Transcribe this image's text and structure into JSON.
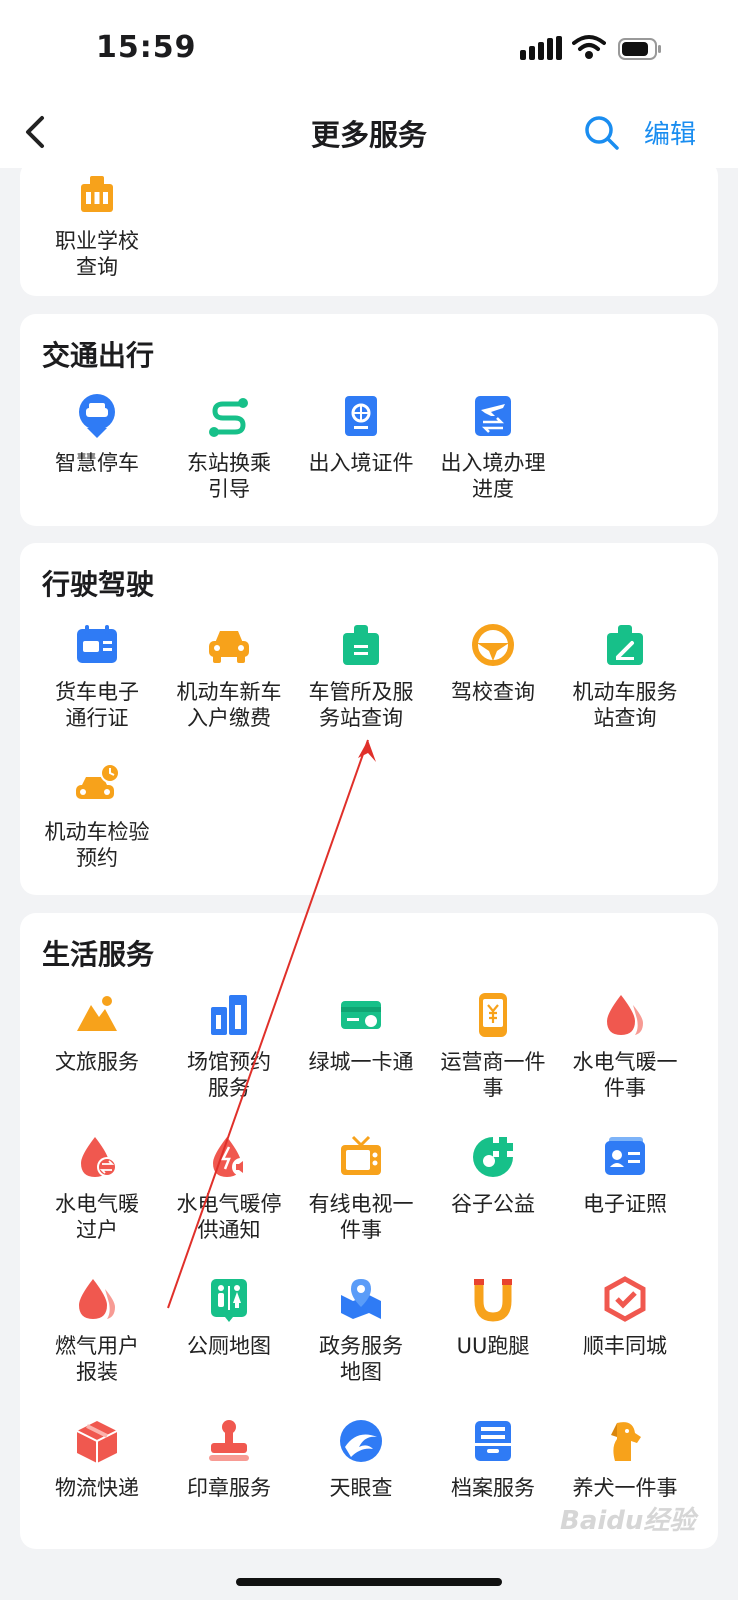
{
  "status": {
    "time": "15:59"
  },
  "nav": {
    "title": "更多服务",
    "edit_label": "编辑"
  },
  "sections": {
    "edu": {
      "items": [
        {
          "label": "职业学校\n查询",
          "icon": "school-icon",
          "color": "#f7a21b"
        }
      ]
    },
    "traffic": {
      "title": "交通出行",
      "items": [
        {
          "label": "智慧停车",
          "icon": "parking-icon",
          "color": "#2f7bf5"
        },
        {
          "label": "东站换乘\n引导",
          "icon": "route-icon",
          "color": "#17c089"
        },
        {
          "label": "出入境证件",
          "icon": "passport-icon",
          "color": "#2f7bf5"
        },
        {
          "label": "出入境办理\n进度",
          "icon": "flight-progress-icon",
          "color": "#2f7bf5"
        }
      ]
    },
    "driving": {
      "title": "行驶驾驶",
      "items": [
        {
          "label": "货车电子\n通行证",
          "icon": "truck-pass-icon",
          "color": "#2f7bf5"
        },
        {
          "label": "机动车新车\n入户缴费",
          "icon": "car-icon",
          "color": "#f7a21b"
        },
        {
          "label": "车管所及服\n务站查询",
          "icon": "office-badge-icon",
          "color": "#17c089"
        },
        {
          "label": "驾校查询",
          "icon": "steering-wheel-icon",
          "color": "#f7a21b"
        },
        {
          "label": "机动车服务\n站查询",
          "icon": "station-icon",
          "color": "#17c089"
        },
        {
          "label": "机动车检验\n预约",
          "icon": "car-clock-icon",
          "color": "#f7a21b"
        }
      ]
    },
    "life": {
      "title": "生活服务",
      "items": [
        {
          "label": "文旅服务",
          "icon": "scenery-icon",
          "color": "#f7a21b"
        },
        {
          "label": "场馆预约\n服务",
          "icon": "building-icon",
          "color": "#2f7bf5"
        },
        {
          "label": "绿城一卡通",
          "icon": "card-icon",
          "color": "#17c089"
        },
        {
          "label": "运营商一件\n事",
          "icon": "phone-icon",
          "color": "#f7a21b"
        },
        {
          "label": "水电气暖一\n件事",
          "icon": "drop-icon",
          "color": "#f0584f"
        },
        {
          "label": "水电气暖\n过户",
          "icon": "drop-transfer-icon",
          "color": "#f0584f"
        },
        {
          "label": "水电气暖停\n供通知",
          "icon": "drop-notice-icon",
          "color": "#f0584f"
        },
        {
          "label": "有线电视一\n件事",
          "icon": "tv-icon",
          "color": "#f7a21b"
        },
        {
          "label": "谷子公益",
          "icon": "charity-icon",
          "color": "#17c089"
        },
        {
          "label": "电子证照",
          "icon": "id-card-icon",
          "color": "#2f7bf5"
        },
        {
          "label": "燃气用户\n报装",
          "icon": "gas-icon",
          "color": "#f0584f"
        },
        {
          "label": "公厕地图",
          "icon": "toilet-icon",
          "color": "#17c089"
        },
        {
          "label": "政务服务\n地图",
          "icon": "map-icon",
          "color": "#2f7bf5"
        },
        {
          "label": "UU跑腿",
          "icon": "magnet-icon",
          "color": "#f7a21b"
        },
        {
          "label": "顺丰同城",
          "icon": "sf-icon",
          "color": "#f0584f"
        },
        {
          "label": "物流快递",
          "icon": "package-icon",
          "color": "#f0584f"
        },
        {
          "label": "印章服务",
          "icon": "stamp-icon",
          "color": "#f0584f"
        },
        {
          "label": "天眼查",
          "icon": "tianyancha-icon",
          "color": "#2f7bf5"
        },
        {
          "label": "档案服务",
          "icon": "archive-icon",
          "color": "#2f7bf5"
        },
        {
          "label": "养犬一件事",
          "icon": "dog-icon",
          "color": "#f7a21b"
        }
      ]
    }
  },
  "watermark": "Baidu经验"
}
